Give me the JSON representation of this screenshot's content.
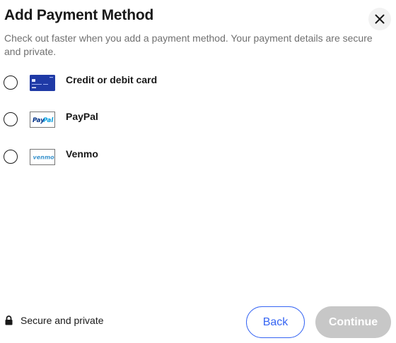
{
  "dialog": {
    "title": "Add Payment Method",
    "subtitle": "Check out faster when you add a payment method. Your payment details are secure and private.",
    "close_icon": "close-icon"
  },
  "payment_options": [
    {
      "label": "Credit or debit card",
      "icon": "credit-card-icon",
      "selected": false
    },
    {
      "label": "PayPal",
      "icon": "paypal-logo",
      "logo_text": "PayPal",
      "selected": false
    },
    {
      "label": "Venmo",
      "icon": "venmo-logo",
      "logo_text": "venmo",
      "selected": false
    }
  ],
  "footer": {
    "secure_label": "Secure and private",
    "secure_icon": "lock-icon",
    "back_label": "Back",
    "continue_label": "Continue",
    "continue_disabled": true
  },
  "colors": {
    "primary_blue": "#3665f3",
    "disabled_gray": "#c7c7c7",
    "card_blue": "#1f3aa6",
    "paypal_navy": "#003087",
    "paypal_blue": "#009cde",
    "venmo_blue": "#3d95ce"
  }
}
